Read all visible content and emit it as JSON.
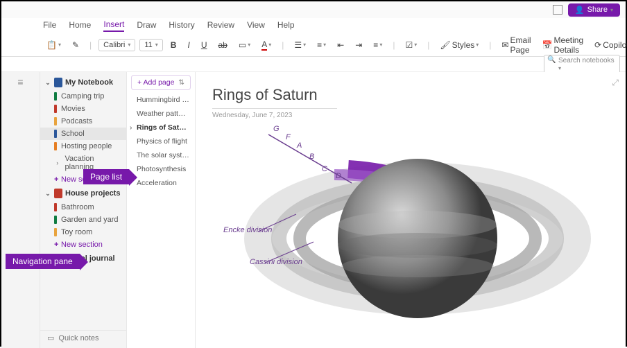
{
  "titlebar": {
    "share_label": "Share"
  },
  "menubar": {
    "items": [
      "File",
      "Home",
      "Insert",
      "Draw",
      "History",
      "Review",
      "View",
      "Help"
    ],
    "active_index": 2
  },
  "ribbon": {
    "font_name": "Calibri",
    "font_size": "11",
    "styles_label": "Styles",
    "email_page_label": "Email Page",
    "meeting_details_label": "Meeting Details",
    "copilot_label": "Copilot"
  },
  "search": {
    "placeholder": "Search notebooks"
  },
  "notebooks": [
    {
      "name": "My Notebook",
      "color": "#2b579a",
      "expanded": true,
      "sections": [
        {
          "name": "Camping trip",
          "color": "#107c41"
        },
        {
          "name": "Movies",
          "color": "#c0392b"
        },
        {
          "name": "Podcasts",
          "color": "#e8a33d"
        },
        {
          "name": "School",
          "color": "#2b579a",
          "selected": true
        },
        {
          "name": "Hosting people",
          "color": "#e67e22"
        },
        {
          "name": "Vacation planning",
          "color": "",
          "chevron": true
        }
      ]
    },
    {
      "name": "House projects",
      "color": "#c0392b",
      "expanded": true,
      "sections": [
        {
          "name": "Bathroom",
          "color": "#c0392b"
        },
        {
          "name": "Garden and yard",
          "color": "#107c41"
        },
        {
          "name": "Toy room",
          "color": "#e8a33d"
        }
      ]
    },
    {
      "name": "Travel journal",
      "color": "#7f7f7f",
      "expanded": false,
      "sections": []
    }
  ],
  "new_section_label": "New section",
  "quick_notes_label": "Quick notes",
  "page_list": {
    "add_page_label": "Add page",
    "pages": [
      "Hummingbird wing...",
      "Weather patterns",
      "Rings of Saturn",
      "Physics of flight",
      "The solar system",
      "Photosynthesis",
      "Acceleration"
    ],
    "selected_index": 2
  },
  "page": {
    "title": "Rings of Saturn",
    "date": "Wednesday, June 7, 2023",
    "ring_letters": [
      "G",
      "F",
      "A",
      "B",
      "C",
      "D"
    ],
    "encke_label": "Encke division",
    "cassini_label": "Cassini division"
  },
  "callouts": {
    "nav_pane": "Navigation pane",
    "page_list": "Page list"
  }
}
